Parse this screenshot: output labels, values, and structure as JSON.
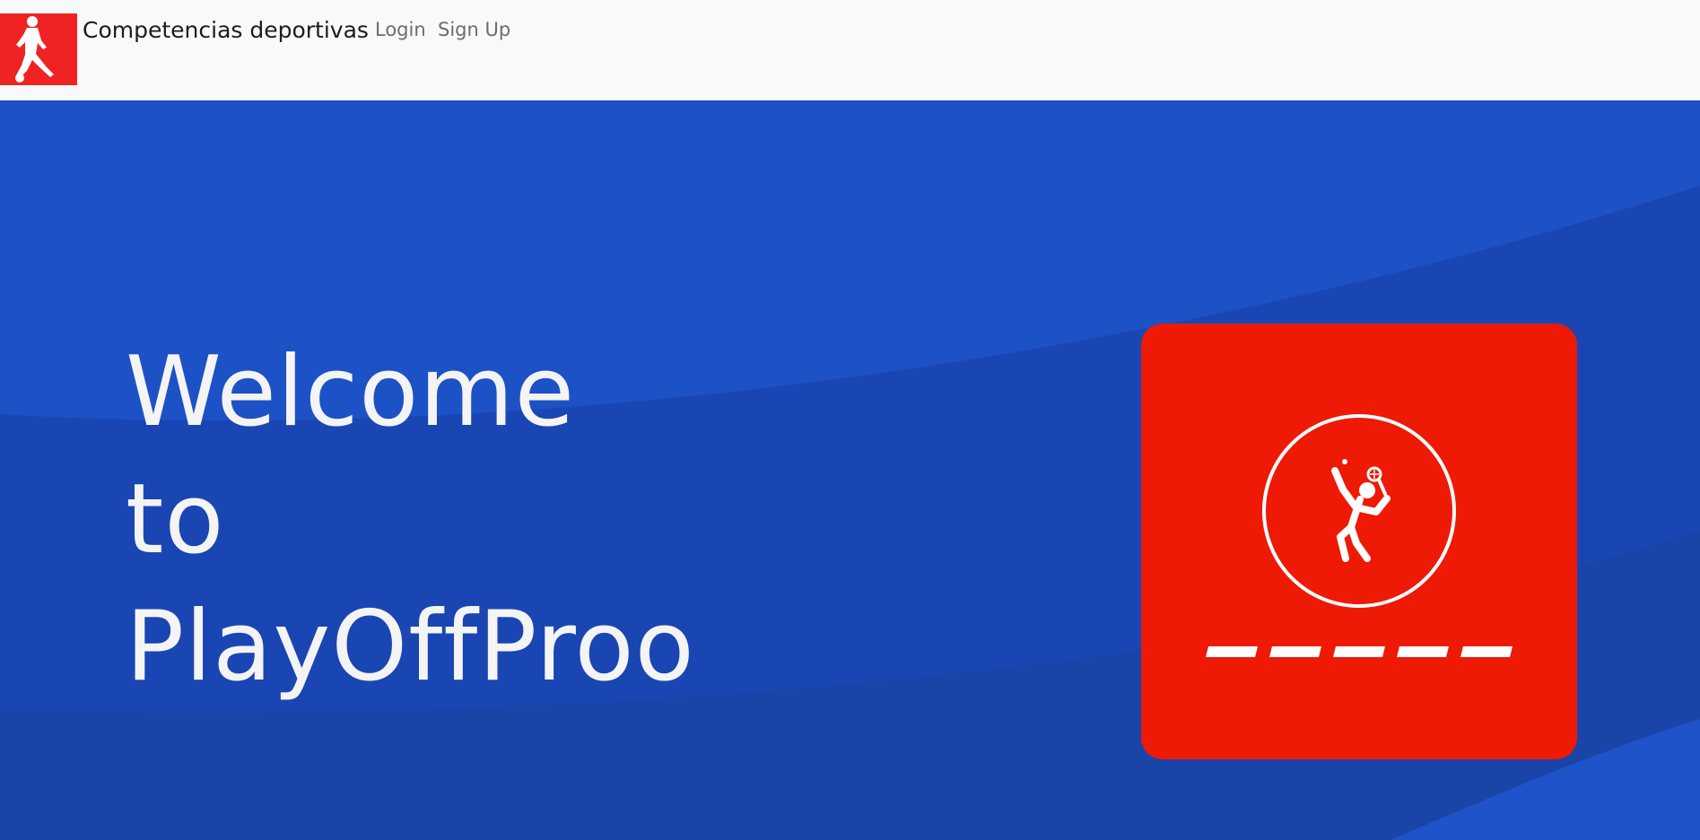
{
  "navbar": {
    "brand": "Competencias deportivas",
    "logo_icon": "soccer-player-icon",
    "links": [
      {
        "label": "Login"
      },
      {
        "label": "Sign Up"
      }
    ]
  },
  "hero": {
    "lines": [
      "Welcome",
      "to",
      "PlayOffProo"
    ],
    "card_icon": "tennis-player-icon",
    "colors": {
      "background": "#1d51c6",
      "card": "#ee1a06",
      "text": "#f4f4f4"
    }
  }
}
